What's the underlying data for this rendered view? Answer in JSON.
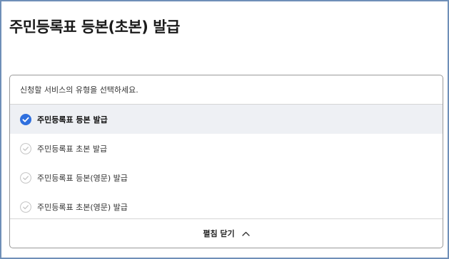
{
  "page": {
    "title": "주민등록표 등본(초본) 발급"
  },
  "panel": {
    "prompt": "신청할 서비스의 유형을 선택하세요.",
    "options": [
      {
        "label": "주민등록표 등본 발급",
        "selected": true
      },
      {
        "label": "주민등록표 초본 발급",
        "selected": false
      },
      {
        "label": "주민등록표 등본(영문) 발급",
        "selected": false
      },
      {
        "label": "주민등록표 초본(영문) 발급",
        "selected": false
      }
    ],
    "toggle_label": "펼침 닫기"
  },
  "colors": {
    "accent": "#2f6fde",
    "frame_border": "#6f8fb8",
    "selected_row": "#eef0f4",
    "unselected_check": "#c4c4c4"
  },
  "icons": {
    "selected": "check-circle-filled-icon",
    "unselected": "check-circle-outline-icon",
    "toggle": "chevron-up-icon"
  }
}
